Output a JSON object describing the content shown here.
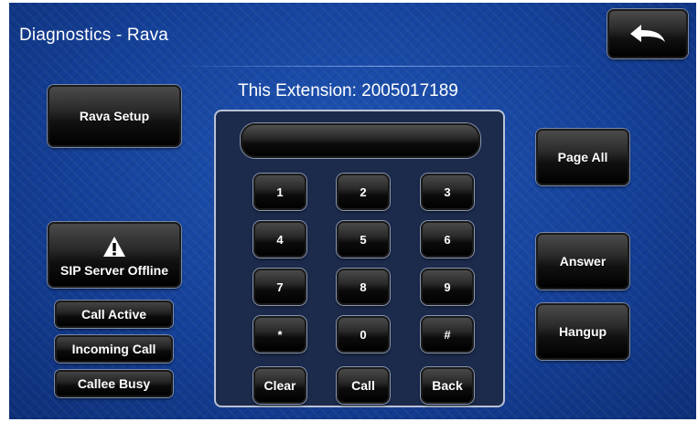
{
  "header": {
    "title": "Diagnostics - Rava",
    "back_icon": "back-arrow-icon"
  },
  "extension_label": "This Extension: 2005017189",
  "left_panel": {
    "rava_setup_label": "Rava Setup",
    "sip_status_icon": "warning-icon",
    "sip_status_label": "SIP Server Offline",
    "status_indicators": [
      "Call Active",
      "Incoming Call",
      "Callee Busy"
    ]
  },
  "keypad": {
    "display_value": "",
    "keys": [
      "1",
      "2",
      "3",
      "4",
      "5",
      "6",
      "7",
      "8",
      "9",
      "*",
      "0",
      "#"
    ],
    "actions": [
      "Clear",
      "Call",
      "Back"
    ]
  },
  "right_panel": {
    "page_all_label": "Page All",
    "answer_label": "Answer",
    "hangup_label": "Hangup"
  },
  "colors": {
    "background": "#15419a",
    "button": "#000000",
    "text": "#ffffff",
    "panel": "#1c2a4c"
  }
}
